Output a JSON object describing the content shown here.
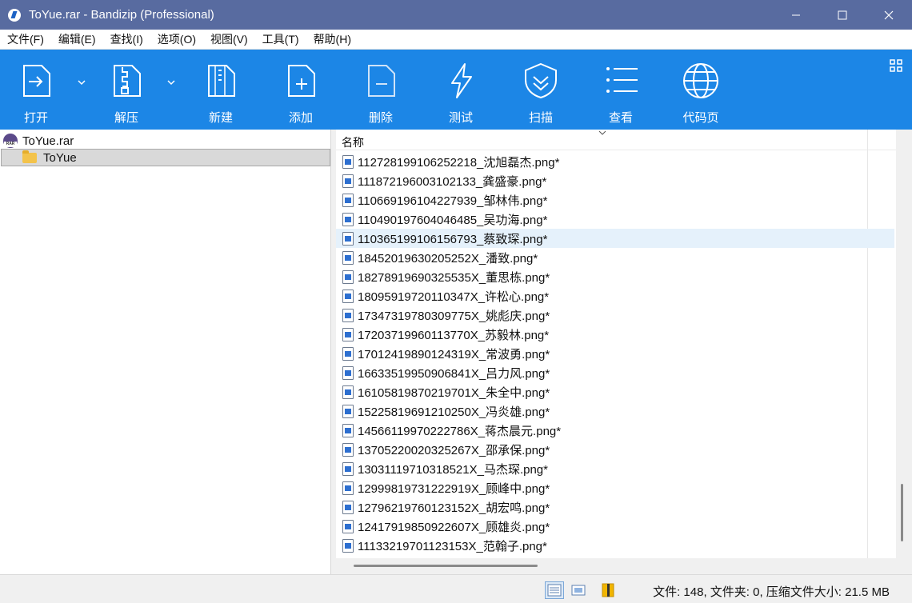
{
  "window": {
    "title": "ToYue.rar - Bandizip (Professional)",
    "controls": {
      "minimize": "—",
      "maximize": "☐",
      "close": "✕"
    }
  },
  "menu": [
    "文件(F)",
    "编辑(E)",
    "查找(I)",
    "选项(O)",
    "视图(V)",
    "工具(T)",
    "帮助(H)"
  ],
  "toolbar": {
    "open": "打开",
    "extract": "解压",
    "new": "新建",
    "add": "添加",
    "delete": "删除",
    "test": "测试",
    "scan": "扫描",
    "view": "查看",
    "codepage": "代码页"
  },
  "tree": {
    "root": "ToYue.rar",
    "folder": "ToYue"
  },
  "file_list": {
    "column_name": "名称",
    "selected_index": 4,
    "files": [
      "11272819910625221​8_沈旭磊杰.png*",
      "111872196003102133_龚盛豪.png*",
      "110669196104227939_邹林伟.png*",
      "110490197604046485_吴功海.png*",
      "110365199106156793_蔡致琛.png*",
      "18452019630205252X_潘致.png*",
      "18278919690325535X_董思栋.png*",
      "18095919720110347X_许松心.png*",
      "17347319780309775X_姚彪庆.png*",
      "17203719960113770X_苏毅林.png*",
      "17012419890124319X_常波勇.png*",
      "16633519950906841X_吕力风.png*",
      "16105819870219701X_朱全中.png*",
      "15225819691210250X_冯炎雄.png*",
      "14566119970222786X_蒋杰晨元.png*",
      "13705220020325267X_邵承保.png*",
      "13031119710318521X_马杰琛.png*",
      "12999819731222919X_顾峰中.png*",
      "12796219760123152X_胡宏鸣.png*",
      "12417919850922607X_顾雄炎.png*",
      "11133219701123153X_范翰子.png*"
    ]
  },
  "status": {
    "text": "文件: 148, 文件夹: 0, 压缩文件大小: 21.5 MB"
  },
  "colors": {
    "titlebar": "#586ba0",
    "toolbar": "#1c86e6",
    "selected_row": "#e5f1fb"
  }
}
